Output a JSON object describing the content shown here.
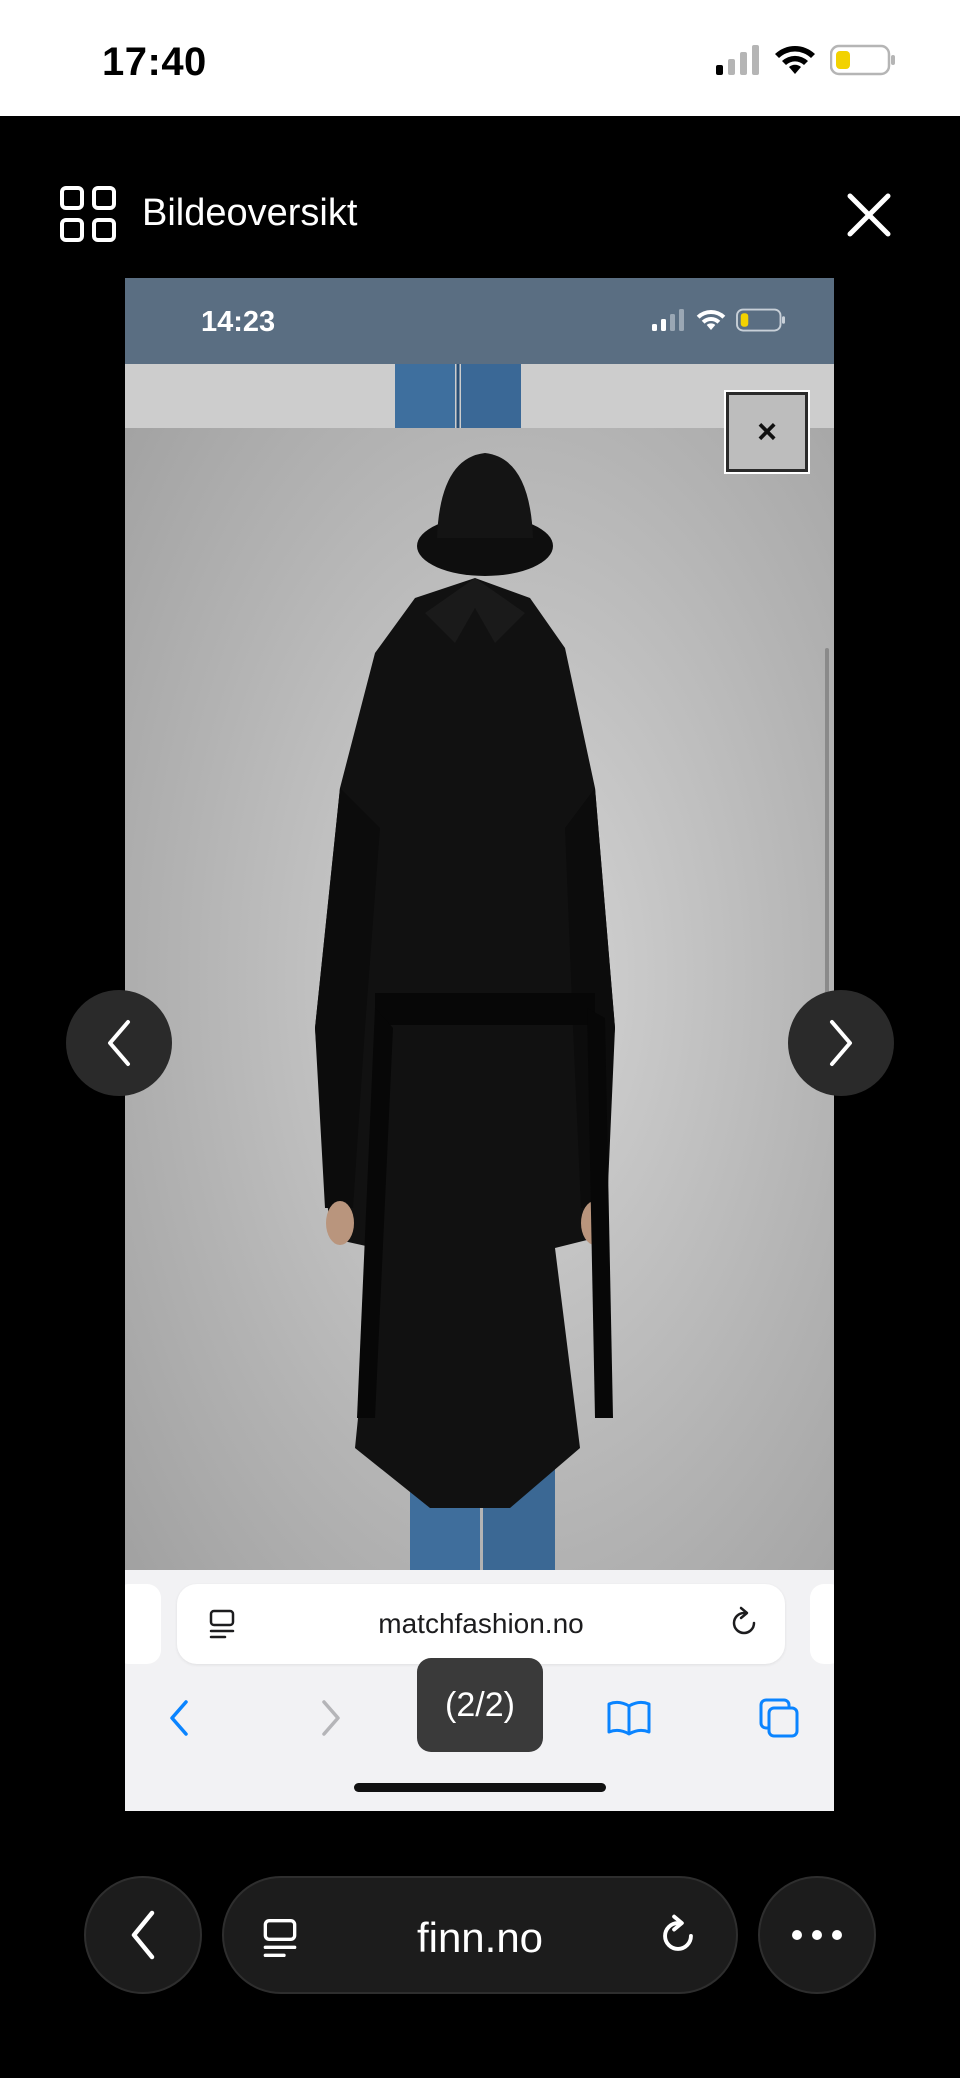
{
  "status_bar": {
    "time": "17:40",
    "battery_color": "#f2d200"
  },
  "viewer": {
    "title": "Bildeoversikt"
  },
  "inner_screenshot": {
    "status_time": "14:23",
    "close_label": "×",
    "url": "matchfashion.no",
    "page_counter": "(2/2)",
    "status_bar_color": "#5a6e82",
    "accent_color": "#0a84ff"
  },
  "bottom_bar": {
    "url": "finn.no"
  },
  "icons": {
    "grid": "grid-icon",
    "close": "close-icon",
    "prev": "chevron-left-icon",
    "next": "chevron-right-icon",
    "more": "more-dots-icon",
    "reload": "reload-icon",
    "tab_settings": "page-settings-icon"
  }
}
